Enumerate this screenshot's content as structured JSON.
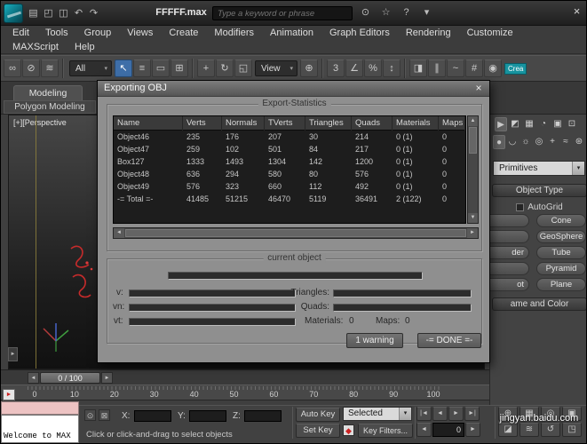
{
  "icons": {
    "chevron_down": "▾",
    "close": "×",
    "up": "▲",
    "down": "▼",
    "left": "◄",
    "right": "►"
  },
  "titlebar": {
    "title": "FFFFF.max",
    "search_placeholder": "Type a keyword or phrase",
    "quick_icons": [
      {
        "name": "new-scene-icon",
        "glyph": "▤"
      },
      {
        "name": "open-file-icon",
        "glyph": "◰"
      },
      {
        "name": "save-file-icon",
        "glyph": "◫"
      },
      {
        "name": "undo-icon",
        "glyph": "↶"
      },
      {
        "name": "redo-icon",
        "glyph": "↷"
      }
    ],
    "right_icons": [
      {
        "name": "search-icon",
        "glyph": "⊙"
      },
      {
        "name": "communication-center-icon",
        "glyph": "☆"
      },
      {
        "name": "help-icon",
        "glyph": "?"
      },
      {
        "name": "help-menu-arrow-icon",
        "glyph": "▾"
      }
    ]
  },
  "menubar": {
    "row1": [
      "Edit",
      "Tools",
      "Group",
      "Views",
      "Create",
      "Modifiers",
      "Animation",
      "Graph Editors",
      "Rendering",
      "Customize"
    ],
    "row2": [
      "MAXScript",
      "Help"
    ]
  },
  "toolbar": {
    "items": [
      {
        "type": "icon",
        "name": "select-and-link-icon",
        "glyph": "∞"
      },
      {
        "type": "icon",
        "name": "unlink-selection-icon",
        "glyph": "⊘"
      },
      {
        "type": "icon",
        "name": "bind-to-space-warp-icon",
        "glyph": "≋"
      },
      {
        "type": "divider"
      },
      {
        "type": "dropdown",
        "name": "selection-filter-dropdown",
        "label": "All"
      },
      {
        "type": "icon",
        "name": "select-object-icon",
        "glyph": "↖",
        "active": true
      },
      {
        "type": "icon",
        "name": "select-by-name-icon",
        "glyph": "≡"
      },
      {
        "type": "icon",
        "name": "rectangular-selection-region-icon",
        "glyph": "▭"
      },
      {
        "type": "icon",
        "name": "window-crossing-icon",
        "glyph": "⊞"
      },
      {
        "type": "divider"
      },
      {
        "type": "icon",
        "name": "select-and-move-icon",
        "glyph": "+"
      },
      {
        "type": "icon",
        "name": "select-and-rotate-icon",
        "glyph": "↻"
      },
      {
        "type": "icon",
        "name": "select-and-scale-icon",
        "glyph": "◱"
      },
      {
        "type": "dropdown",
        "name": "reference-coordinate-dropdown",
        "label": "View"
      },
      {
        "type": "icon",
        "name": "use-pivot-center-icon",
        "glyph": "⊕"
      },
      {
        "type": "divider"
      },
      {
        "type": "icon",
        "name": "snap-toggle-icon",
        "glyph": "3"
      },
      {
        "type": "icon",
        "name": "angle-snap-icon",
        "glyph": "∠"
      },
      {
        "type": "icon",
        "name": "percent-snap-icon",
        "glyph": "%"
      },
      {
        "type": "icon",
        "name": "spinner-snap-icon",
        "glyph": "↕"
      },
      {
        "type": "divider"
      },
      {
        "type": "icon",
        "name": "mirror-icon",
        "glyph": "◨"
      },
      {
        "type": "icon",
        "name": "align-icon",
        "glyph": "∥"
      },
      {
        "type": "icon",
        "name": "curve-editor-icon",
        "glyph": "~"
      },
      {
        "type": "icon",
        "name": "schematic-view-icon",
        "glyph": "#"
      },
      {
        "type": "icon",
        "name": "render-setup-icon",
        "glyph": "◉"
      },
      {
        "type": "badge",
        "name": "create-badge",
        "label": "Crea"
      }
    ]
  },
  "ribbon": {
    "tab1": "Modeling",
    "tab2": "Polygon Modeling"
  },
  "viewport": {
    "label": "[+][Perspective"
  },
  "dialog": {
    "title": "Exporting OBJ",
    "stats_legend": "Export-Statistics",
    "current_legend": "current object",
    "table": {
      "columns": [
        "Name",
        "Verts",
        "Normals",
        "TVerts",
        "Triangles",
        "Quads",
        "Materials",
        "Maps"
      ],
      "rows": [
        [
          "Object46",
          "235",
          "176",
          "207",
          "30",
          "214",
          "0 (1)",
          "0"
        ],
        [
          "Object47",
          "259",
          "102",
          "501",
          "84",
          "217",
          "0 (1)",
          "0"
        ],
        [
          "Box127",
          "1333",
          "1493",
          "1304",
          "142",
          "1200",
          "0 (1)",
          "0"
        ],
        [
          "Object48",
          "636",
          "294",
          "580",
          "80",
          "576",
          "0 (1)",
          "0"
        ],
        [
          "Object49",
          "576",
          "323",
          "660",
          "112",
          "492",
          "0 (1)",
          "0"
        ],
        [
          "-= Total =-",
          "41485",
          "51215",
          "46470",
          "5119",
          "36491",
          "2 (122)",
          "0"
        ]
      ]
    },
    "labels": {
      "v": "v:",
      "vn": "vn:",
      "vt": "vt:",
      "triangles": "Triangles:",
      "quads": "Quads:",
      "materials_label": "Materials:",
      "materials_value": "0",
      "maps_label": "Maps:",
      "maps_value": "0"
    },
    "buttons": {
      "warning": "1 warning",
      "done": "-= DONE =-"
    }
  },
  "command_panel": {
    "tabs": [
      {
        "name": "create-tab-icon",
        "glyph": "▶",
        "active": true
      },
      {
        "name": "modify-tab-icon",
        "glyph": "◩"
      },
      {
        "name": "hierarchy-tab-icon",
        "glyph": "▦"
      },
      {
        "name": "motion-tab-icon",
        "glyph": "◔"
      },
      {
        "name": "display-tab-icon",
        "glyph": "▣"
      },
      {
        "name": "utilities-tab-icon",
        "glyph": "⊡"
      }
    ],
    "categories": [
      {
        "name": "geometry-category-icon",
        "glyph": "●",
        "active": true
      },
      {
        "name": "shapes-category-icon",
        "glyph": "◡"
      },
      {
        "name": "lights-category-icon",
        "glyph": "☼"
      },
      {
        "name": "cameras-category-icon",
        "glyph": "◎"
      },
      {
        "name": "helpers-category-icon",
        "glyph": "+"
      },
      {
        "name": "space-warps-category-icon",
        "glyph": "≈"
      },
      {
        "name": "systems-category-icon",
        "glyph": "⊛"
      }
    ],
    "primitives_label": "Primitives",
    "object_type_label": "Object Type",
    "autogrid_label": "AutoGrid",
    "object_type_rows": [
      {
        "left": "",
        "right": "Cone"
      },
      {
        "left": "",
        "right": "GeoSphere"
      },
      {
        "left": "der",
        "right": "Tube"
      },
      {
        "left": "",
        "right": "Pyramid"
      },
      {
        "left": "ot",
        "right": "Plane"
      }
    ],
    "name_color_label": "ame and Color"
  },
  "timeline": {
    "slider_label": "0 / 100",
    "ticks": [
      "0",
      "10",
      "20",
      "30",
      "40",
      "50",
      "60",
      "70",
      "80",
      "90",
      "100"
    ]
  },
  "statusbar": {
    "mini_listener_text": "Welcome to MAX",
    "prompt": "Click or click-and-drag to select objects",
    "x_label": "X:",
    "y_label": "Y:",
    "z_label": "Z:",
    "x_value": "",
    "y_value": "",
    "z_value": "",
    "auto_key": "Auto Key",
    "selected": "Selected",
    "set_key": "Set Key",
    "key_filters": "Key Filters...",
    "key_icon_glyph": "◆",
    "time_value": "0",
    "playback_row1": [
      {
        "name": "go-to-start-icon",
        "glyph": "|◄"
      },
      {
        "name": "previous-frame-icon",
        "glyph": "◄"
      },
      {
        "name": "play-animation-icon",
        "glyph": "►"
      },
      {
        "name": "go-to-end-icon",
        "glyph": "►|"
      }
    ],
    "nav_icons": [
      {
        "name": "zoom-icon",
        "glyph": "⊕"
      },
      {
        "name": "zoom-all-icon",
        "glyph": "▦"
      },
      {
        "name": "zoom-extents-icon",
        "glyph": "◎"
      },
      {
        "name": "zoom-region-icon",
        "glyph": "▣"
      },
      {
        "name": "field-of-view-icon",
        "glyph": "◪"
      },
      {
        "name": "pan-view-icon",
        "glyph": "≋"
      },
      {
        "name": "orbit-icon",
        "glyph": "↺"
      },
      {
        "name": "maximize-viewport-icon",
        "glyph": "◳"
      }
    ],
    "watermark": "jingyan.baidu.com"
  }
}
